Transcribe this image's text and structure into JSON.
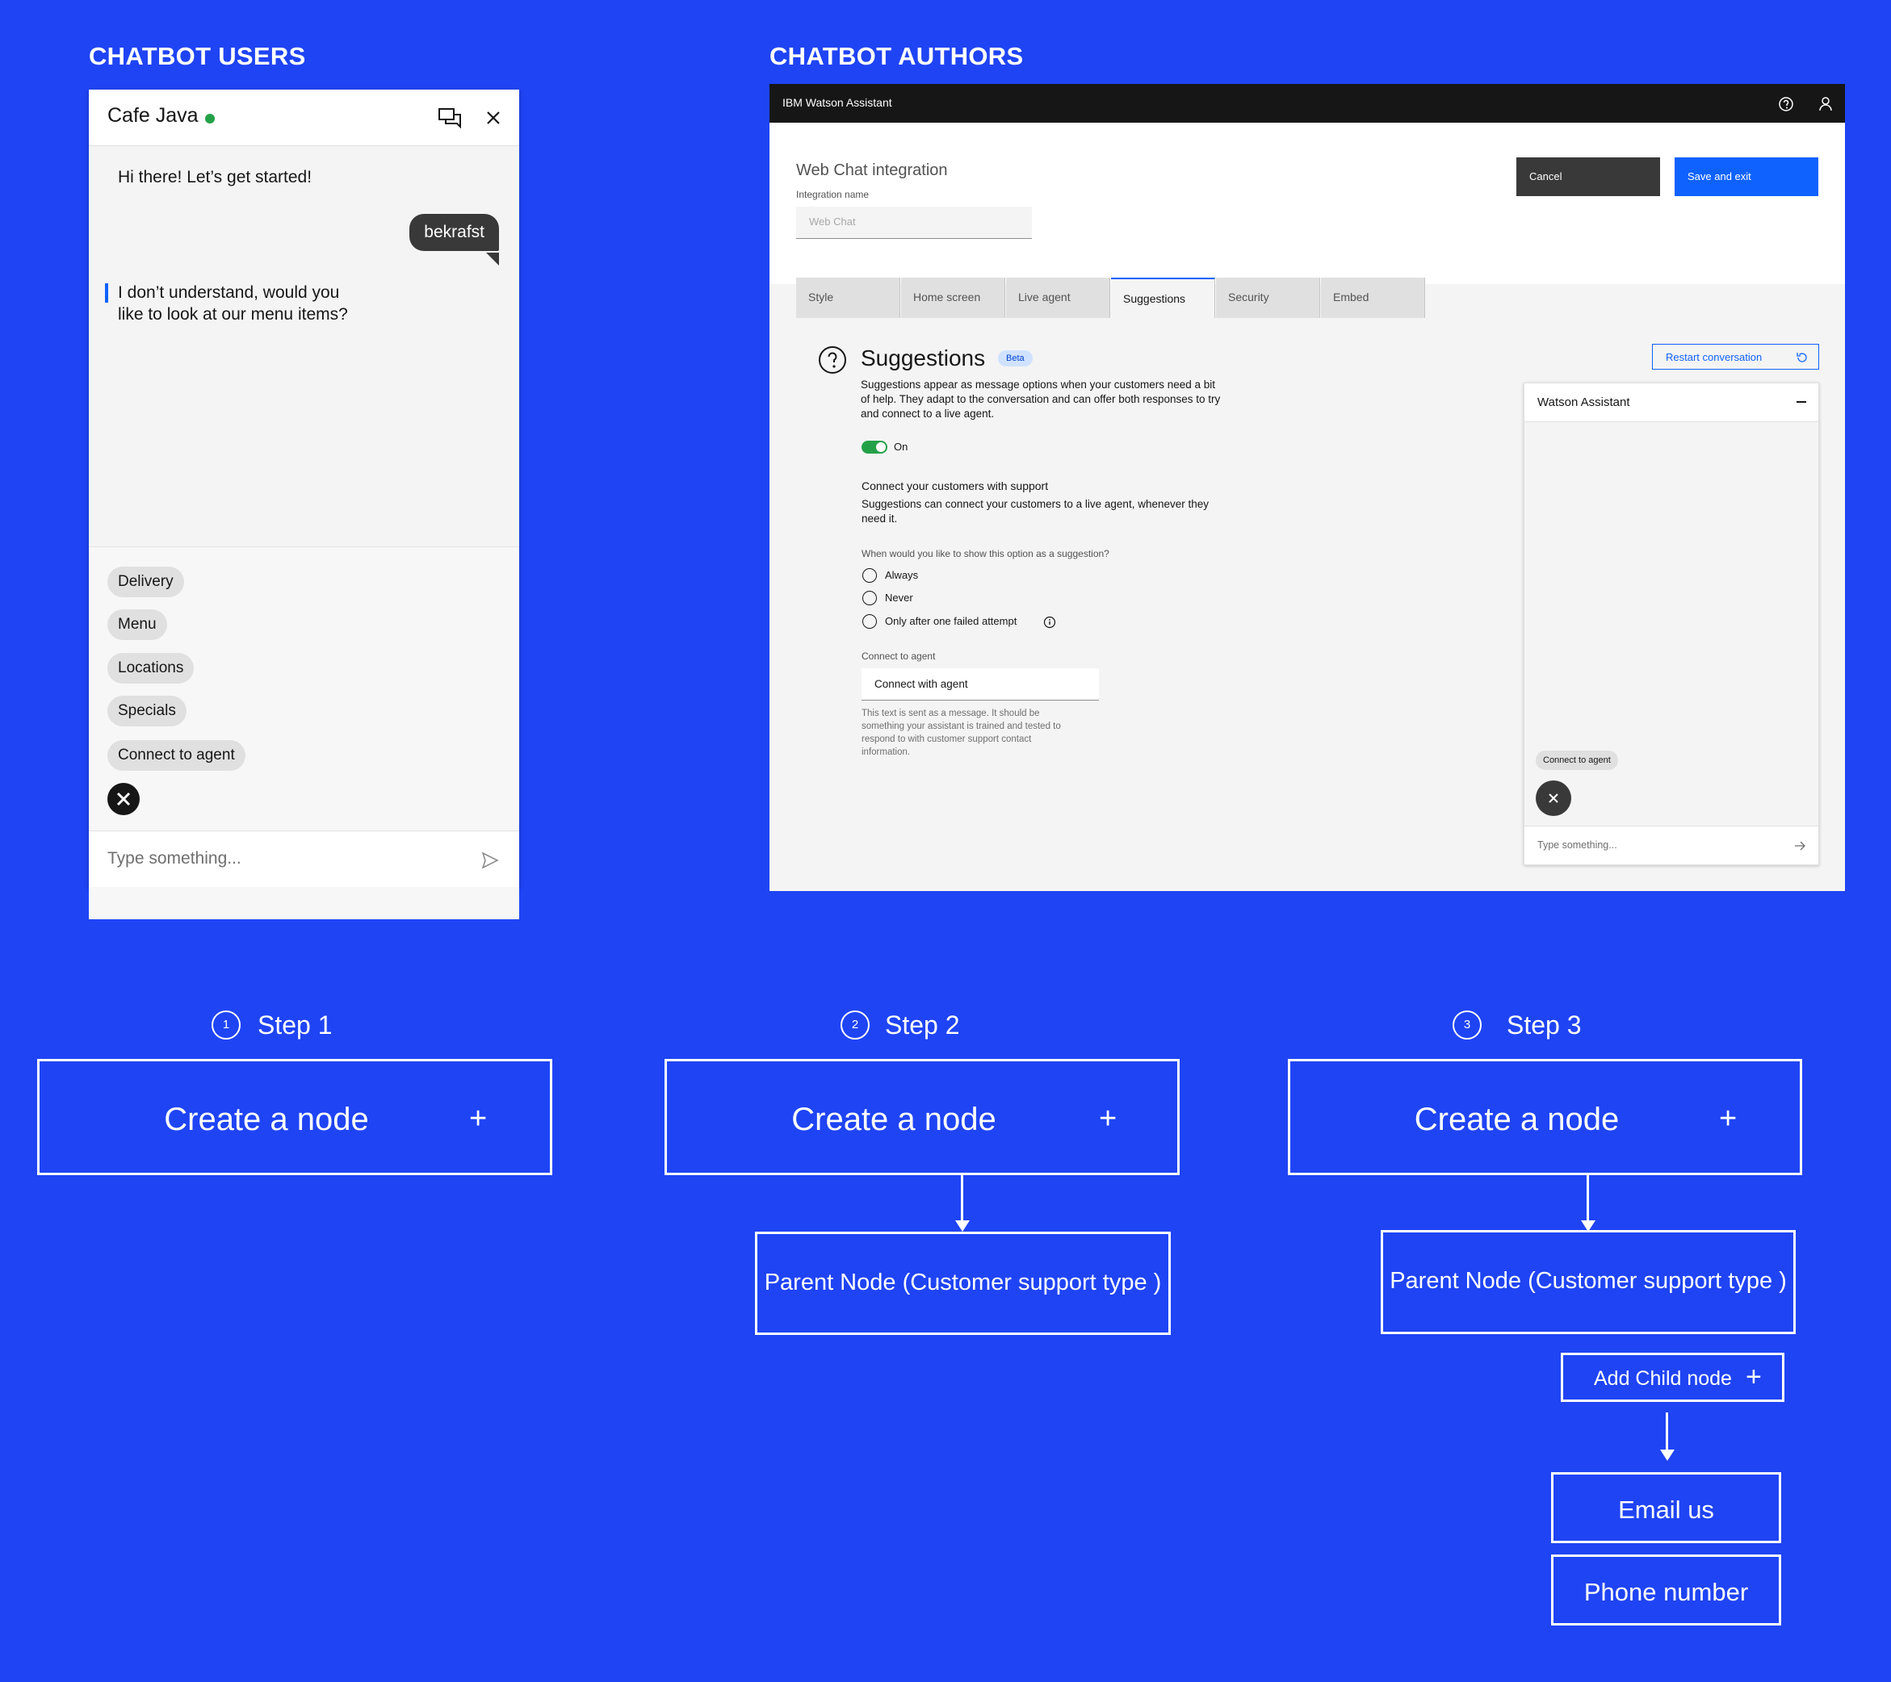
{
  "sections": {
    "users_title": "CHATBOT USERS",
    "authors_title": "CHATBOT AUTHORS"
  },
  "user_chat": {
    "title": "Cafe Java",
    "status_color": "#24a148",
    "header_icons": [
      "chat-bubbles-icon",
      "close-icon"
    ],
    "messages": {
      "bot_greeting": "Hi there! Let’s get started!",
      "user_message": "bekrafst",
      "bot_reply_line1": "I don’t understand, would you",
      "bot_reply_line2": "like to look at our menu items?"
    },
    "suggestions": [
      "Delivery",
      "Menu",
      "Locations",
      "Specials",
      "Connect to agent"
    ],
    "input_placeholder": "Type something..."
  },
  "author": {
    "brand": "IBM Watson Assistant",
    "page_title": "Web Chat integration",
    "integration_name_label": "Integration name",
    "integration_name_placeholder": "Web Chat",
    "cancel_label": "Cancel",
    "save_label": "Save and exit",
    "tabs": [
      "Style",
      "Home screen",
      "Live agent",
      "Suggestions",
      "Security",
      "Embed"
    ],
    "active_tab": "Suggestions",
    "suggestions_title": "Suggestions",
    "beta_badge": "Beta",
    "description_line1": "Suggestions appear as message options when your customers need a bit",
    "description_line2": "of help. They adapt to the conversation and can offer both responses to try",
    "description_line3": "and connect to a live agent.",
    "toggle_label": "On",
    "connect_heading": "Connect your customers with support",
    "connect_desc_line1": "Suggestions can connect your customers to a live agent, whenever they",
    "connect_desc_line2": "need it.",
    "question": "When would you like to show this option as a suggestion?",
    "radio_options": [
      "Always",
      "Never",
      "Only after one failed attempt"
    ],
    "connect_field_label": "Connect to agent",
    "connect_field_value": "Connect with agent",
    "helper_line1": "This text is sent as a message. It should be",
    "helper_line2": "something your assistant is trained and tested to",
    "helper_line3": "respond to with customer support contact",
    "helper_line4": "information.",
    "restart_label": "Restart conversation",
    "preview_title": "Watson Assistant",
    "preview_chip": "Connect to agent",
    "preview_placeholder": "Type something..."
  },
  "flow": {
    "steps": [
      {
        "number": "1",
        "label": "Step 1",
        "node": "Create a node"
      },
      {
        "number": "2",
        "label": "Step 2",
        "node": "Create a node",
        "parent": "Parent Node (Customer support type )"
      },
      {
        "number": "3",
        "label": "Step 3",
        "node": "Create a node",
        "parent": "Parent Node (Customer support type )",
        "child_button": "Add Child node",
        "children": [
          "Email us",
          "Phone number"
        ]
      }
    ],
    "plus_symbol": "+"
  },
  "colors": {
    "background": "#1f44f4",
    "ibm_blue": "#0f62fe",
    "dark": "#161616",
    "success": "#24a148"
  }
}
